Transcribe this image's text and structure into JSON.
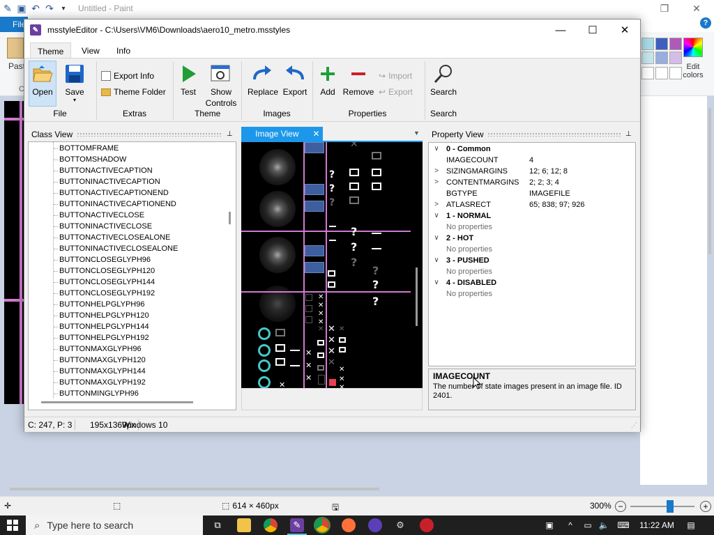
{
  "paint": {
    "title": "Untitled - Paint",
    "file_tab": "File",
    "paste_label": "Paste",
    "clipboard_short": "Cl",
    "edit_colors_label": "Edit colors",
    "status": {
      "dimensions": "614 × 460px",
      "zoom": "300%"
    },
    "swatch_colors": [
      "#a9dce8",
      "#3f5fc0",
      "#b05ab8",
      "#c6e6ee",
      "#97aee0",
      "#d4bde8",
      "#ffffff",
      "#ffffff",
      "#ffffff"
    ]
  },
  "editor": {
    "title": "msstyleEditor - C:\\Users\\VM6\\Downloads\\aero10_metro.msstyles",
    "tabs": [
      "Theme",
      "View",
      "Info"
    ],
    "ribbon": {
      "open": "Open",
      "save": "Save",
      "file_group": "File",
      "export_info": "Export Info",
      "theme_folder": "Theme Folder",
      "extras_group": "Extras",
      "test": "Test",
      "show_controls": "Show Controls",
      "theme_group": "Theme",
      "replace": "Replace",
      "export": "Export",
      "images_group": "Images",
      "add": "Add",
      "remove": "Remove",
      "import_small": "Import",
      "export_small": "Export",
      "properties_group": "Properties",
      "search": "Search",
      "search_group": "Search"
    },
    "class_view": {
      "title": "Class View",
      "items": [
        "BOTTOMFRAME",
        "BOTTOMSHADOW",
        "BUTTONACTIVECAPTION",
        "BUTTONINACTIVECAPTION",
        "BUTTONACTIVECAPTIONEND",
        "BUTTONINACTIVECAPTIONEND",
        "BUTTONACTIVECLOSE",
        "BUTTONINACTIVECLOSE",
        "BUTTONACTIVECLOSEALONE",
        "BUTTONINACTIVECLOSEALONE",
        "BUTTONCLOSEGLYPH96",
        "BUTTONCLOSEGLYPH120",
        "BUTTONCLOSEGLYPH144",
        "BUTTONCLOSEGLYPH192",
        "BUTTONHELPGLYPH96",
        "BUTTONHELPGLYPH120",
        "BUTTONHELPGLYPH144",
        "BUTTONHELPGLYPH192",
        "BUTTONMAXGLYPH96",
        "BUTTONMAXGLYPH120",
        "BUTTONMAXGLYPH144",
        "BUTTONMAXGLYPH192",
        "BUTTONMINGLYPH96"
      ]
    },
    "image_view": {
      "tab_label": "Image View"
    },
    "property_view": {
      "title": "Property View",
      "rows": [
        {
          "type": "cat",
          "chev": "∨",
          "key": "0 - Common",
          "value": ""
        },
        {
          "type": "prop",
          "chev": "",
          "key": "IMAGECOUNT",
          "value": "4"
        },
        {
          "type": "prop",
          "chev": ">",
          "key": "SIZINGMARGINS",
          "value": "12; 6; 12; 8"
        },
        {
          "type": "prop",
          "chev": ">",
          "key": "CONTENTMARGINS",
          "value": "2; 2; 3; 4"
        },
        {
          "type": "prop",
          "chev": "",
          "key": "BGTYPE",
          "value": "IMAGEFILE"
        },
        {
          "type": "prop",
          "chev": ">",
          "key": "ATLASRECT",
          "value": "65; 838; 97; 926"
        },
        {
          "type": "cat",
          "chev": "∨",
          "key": "1 - NORMAL",
          "value": ""
        },
        {
          "type": "np",
          "chev": "",
          "key": "No properties",
          "value": ""
        },
        {
          "type": "cat",
          "chev": "∨",
          "key": "2 - HOT",
          "value": ""
        },
        {
          "type": "np",
          "chev": "",
          "key": "No properties",
          "value": ""
        },
        {
          "type": "cat",
          "chev": "∨",
          "key": "3 - PUSHED",
          "value": ""
        },
        {
          "type": "np",
          "chev": "",
          "key": "No properties",
          "value": ""
        },
        {
          "type": "cat",
          "chev": "∨",
          "key": "4 - DISABLED",
          "value": ""
        },
        {
          "type": "np",
          "chev": "",
          "key": "No properties",
          "value": ""
        }
      ]
    },
    "description": {
      "title": "IMAGECOUNT",
      "body": "The number of state images present in an image file. ID 2401."
    },
    "status": {
      "cursor": "C: 247, P: 3",
      "size": "195x1369px",
      "os": "Windows 10"
    }
  },
  "taskbar": {
    "search_placeholder": "Type here to search",
    "time": "11:22 AM"
  }
}
